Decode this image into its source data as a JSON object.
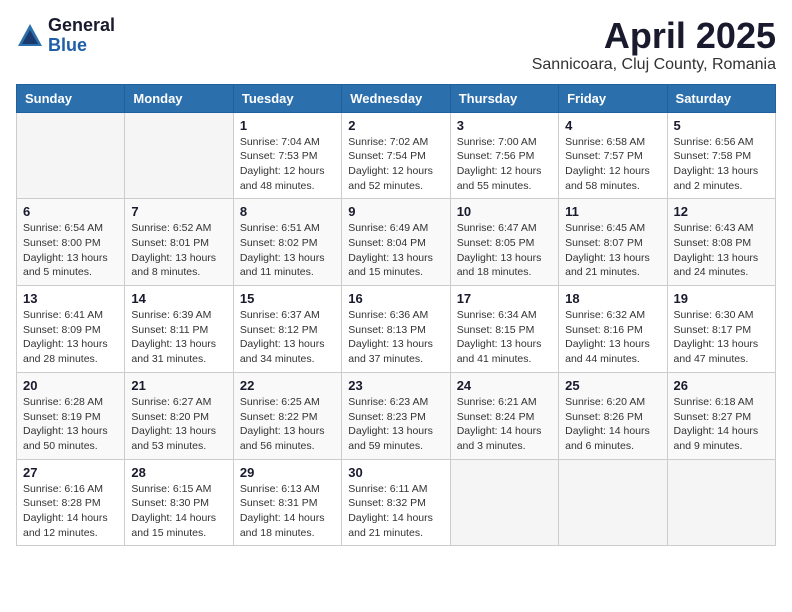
{
  "header": {
    "logo_general": "General",
    "logo_blue": "Blue",
    "month_title": "April 2025",
    "location": "Sannicoara, Cluj County, Romania"
  },
  "days_of_week": [
    "Sunday",
    "Monday",
    "Tuesday",
    "Wednesday",
    "Thursday",
    "Friday",
    "Saturday"
  ],
  "weeks": [
    [
      {
        "day": "",
        "info": ""
      },
      {
        "day": "",
        "info": ""
      },
      {
        "day": "1",
        "info": "Sunrise: 7:04 AM\nSunset: 7:53 PM\nDaylight: 12 hours and 48 minutes."
      },
      {
        "day": "2",
        "info": "Sunrise: 7:02 AM\nSunset: 7:54 PM\nDaylight: 12 hours and 52 minutes."
      },
      {
        "day": "3",
        "info": "Sunrise: 7:00 AM\nSunset: 7:56 PM\nDaylight: 12 hours and 55 minutes."
      },
      {
        "day": "4",
        "info": "Sunrise: 6:58 AM\nSunset: 7:57 PM\nDaylight: 12 hours and 58 minutes."
      },
      {
        "day": "5",
        "info": "Sunrise: 6:56 AM\nSunset: 7:58 PM\nDaylight: 13 hours and 2 minutes."
      }
    ],
    [
      {
        "day": "6",
        "info": "Sunrise: 6:54 AM\nSunset: 8:00 PM\nDaylight: 13 hours and 5 minutes."
      },
      {
        "day": "7",
        "info": "Sunrise: 6:52 AM\nSunset: 8:01 PM\nDaylight: 13 hours and 8 minutes."
      },
      {
        "day": "8",
        "info": "Sunrise: 6:51 AM\nSunset: 8:02 PM\nDaylight: 13 hours and 11 minutes."
      },
      {
        "day": "9",
        "info": "Sunrise: 6:49 AM\nSunset: 8:04 PM\nDaylight: 13 hours and 15 minutes."
      },
      {
        "day": "10",
        "info": "Sunrise: 6:47 AM\nSunset: 8:05 PM\nDaylight: 13 hours and 18 minutes."
      },
      {
        "day": "11",
        "info": "Sunrise: 6:45 AM\nSunset: 8:07 PM\nDaylight: 13 hours and 21 minutes."
      },
      {
        "day": "12",
        "info": "Sunrise: 6:43 AM\nSunset: 8:08 PM\nDaylight: 13 hours and 24 minutes."
      }
    ],
    [
      {
        "day": "13",
        "info": "Sunrise: 6:41 AM\nSunset: 8:09 PM\nDaylight: 13 hours and 28 minutes."
      },
      {
        "day": "14",
        "info": "Sunrise: 6:39 AM\nSunset: 8:11 PM\nDaylight: 13 hours and 31 minutes."
      },
      {
        "day": "15",
        "info": "Sunrise: 6:37 AM\nSunset: 8:12 PM\nDaylight: 13 hours and 34 minutes."
      },
      {
        "day": "16",
        "info": "Sunrise: 6:36 AM\nSunset: 8:13 PM\nDaylight: 13 hours and 37 minutes."
      },
      {
        "day": "17",
        "info": "Sunrise: 6:34 AM\nSunset: 8:15 PM\nDaylight: 13 hours and 41 minutes."
      },
      {
        "day": "18",
        "info": "Sunrise: 6:32 AM\nSunset: 8:16 PM\nDaylight: 13 hours and 44 minutes."
      },
      {
        "day": "19",
        "info": "Sunrise: 6:30 AM\nSunset: 8:17 PM\nDaylight: 13 hours and 47 minutes."
      }
    ],
    [
      {
        "day": "20",
        "info": "Sunrise: 6:28 AM\nSunset: 8:19 PM\nDaylight: 13 hours and 50 minutes."
      },
      {
        "day": "21",
        "info": "Sunrise: 6:27 AM\nSunset: 8:20 PM\nDaylight: 13 hours and 53 minutes."
      },
      {
        "day": "22",
        "info": "Sunrise: 6:25 AM\nSunset: 8:22 PM\nDaylight: 13 hours and 56 minutes."
      },
      {
        "day": "23",
        "info": "Sunrise: 6:23 AM\nSunset: 8:23 PM\nDaylight: 13 hours and 59 minutes."
      },
      {
        "day": "24",
        "info": "Sunrise: 6:21 AM\nSunset: 8:24 PM\nDaylight: 14 hours and 3 minutes."
      },
      {
        "day": "25",
        "info": "Sunrise: 6:20 AM\nSunset: 8:26 PM\nDaylight: 14 hours and 6 minutes."
      },
      {
        "day": "26",
        "info": "Sunrise: 6:18 AM\nSunset: 8:27 PM\nDaylight: 14 hours and 9 minutes."
      }
    ],
    [
      {
        "day": "27",
        "info": "Sunrise: 6:16 AM\nSunset: 8:28 PM\nDaylight: 14 hours and 12 minutes."
      },
      {
        "day": "28",
        "info": "Sunrise: 6:15 AM\nSunset: 8:30 PM\nDaylight: 14 hours and 15 minutes."
      },
      {
        "day": "29",
        "info": "Sunrise: 6:13 AM\nSunset: 8:31 PM\nDaylight: 14 hours and 18 minutes."
      },
      {
        "day": "30",
        "info": "Sunrise: 6:11 AM\nSunset: 8:32 PM\nDaylight: 14 hours and 21 minutes."
      },
      {
        "day": "",
        "info": ""
      },
      {
        "day": "",
        "info": ""
      },
      {
        "day": "",
        "info": ""
      }
    ]
  ]
}
